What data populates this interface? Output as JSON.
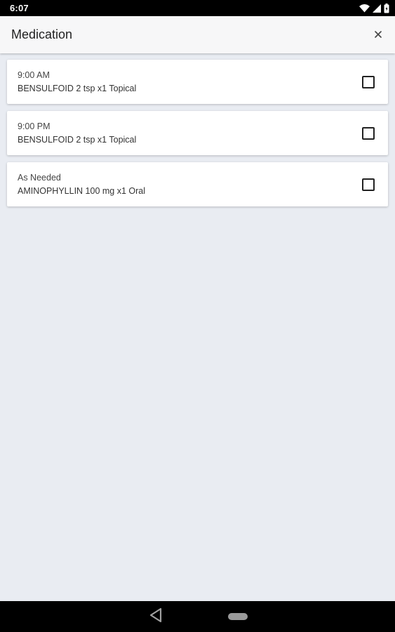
{
  "status_bar": {
    "time": "6:07",
    "icons": [
      "wifi-icon",
      "signal-icon",
      "battery-icon"
    ]
  },
  "app_bar": {
    "title": "Medication",
    "close_icon": "close-icon"
  },
  "medications": [
    {
      "time": "9:00 AM",
      "description": "BENSULFOID 2 tsp x1 Topical",
      "checked": false
    },
    {
      "time": "9:00 PM",
      "description": "BENSULFOID 2 tsp x1 Topical",
      "checked": false
    },
    {
      "time": "As Needed",
      "description": "AMINOPHYLLIN 100 mg x1 Oral",
      "checked": false
    }
  ],
  "nav_bar": {
    "icons": [
      "back-icon",
      "home-icon"
    ]
  },
  "colors": {
    "background": "#e9ecf2",
    "app_bar": "#f7f7f8",
    "card": "#ffffff",
    "system_bar": "#000000"
  }
}
